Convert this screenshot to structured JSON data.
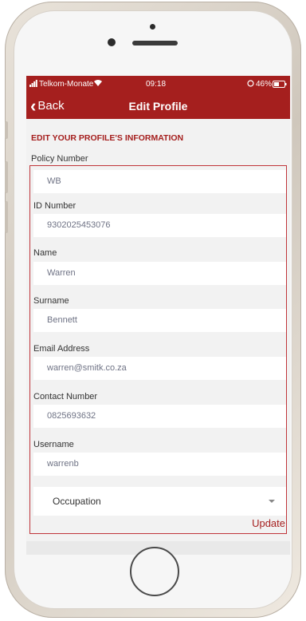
{
  "status_bar": {
    "carrier": "Telkom-Monate",
    "time": "09:18",
    "battery": "46%"
  },
  "nav": {
    "back_label": "Back",
    "title": "Edit Profile"
  },
  "section_title": "EDIT YOUR PROFILE'S INFORMATION",
  "fields": [
    {
      "label": "Policy Number",
      "value": "WB"
    },
    {
      "label": "ID Number",
      "value": "9302025453076"
    },
    {
      "label": "Name",
      "value": "Warren"
    },
    {
      "label": "Surname",
      "value": "Bennett"
    },
    {
      "label": "Email Address",
      "value": "warren@smitk.co.za"
    },
    {
      "label": "Contact Number",
      "value": "0825693632"
    },
    {
      "label": "Username",
      "value": "warrenb"
    }
  ],
  "occupation": {
    "label": "Occupation"
  },
  "update_label": "Update",
  "colors": {
    "brand": "#a51f1e",
    "highlight_border": "#c0353a"
  },
  "icons": [
    "signal-icon",
    "wifi-icon",
    "alarm-icon",
    "battery-icon",
    "chevron-left-icon",
    "chevron-down-icon"
  ]
}
